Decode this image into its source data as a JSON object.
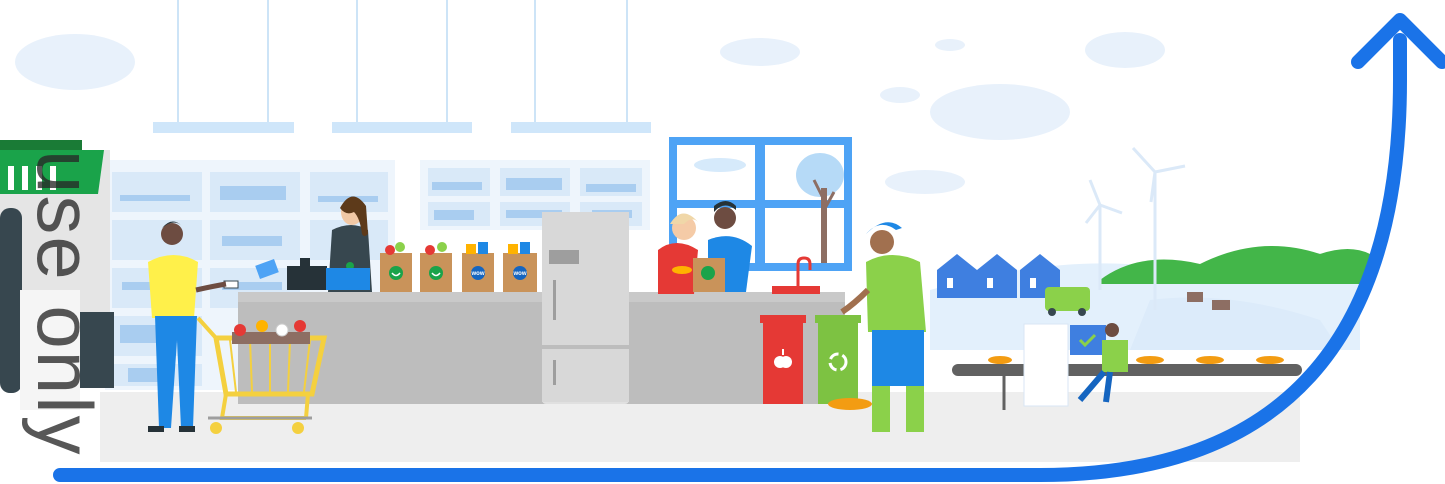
{
  "watermark": {
    "text": "use only"
  },
  "bags": [
    {
      "kind": "woolworths",
      "label": ""
    },
    {
      "kind": "woolworths",
      "label": ""
    },
    {
      "kind": "brand",
      "label": "wow"
    },
    {
      "kind": "brand",
      "label": "wow"
    }
  ],
  "colors": {
    "sky": "#ffffff",
    "cloud": "#e8f1fb",
    "shelf": "#cfe3f7",
    "counter": "#b9b9b9",
    "floor": "#eeeeee",
    "arrow": "#1a73e8",
    "brand_green": "#1aa34a",
    "lime": "#8bd14a",
    "bin_red": "#e53935",
    "bin_green": "#7dc242",
    "bag_kraft": "#c9935a",
    "window_frame": "#4ea3f5",
    "house": "#3f7fe0",
    "hills": "#43b649"
  },
  "icons": [
    "apple-icon",
    "recycle-icon",
    "checkmark-icon",
    "wind-turbine-icon",
    "cow-icon"
  ]
}
